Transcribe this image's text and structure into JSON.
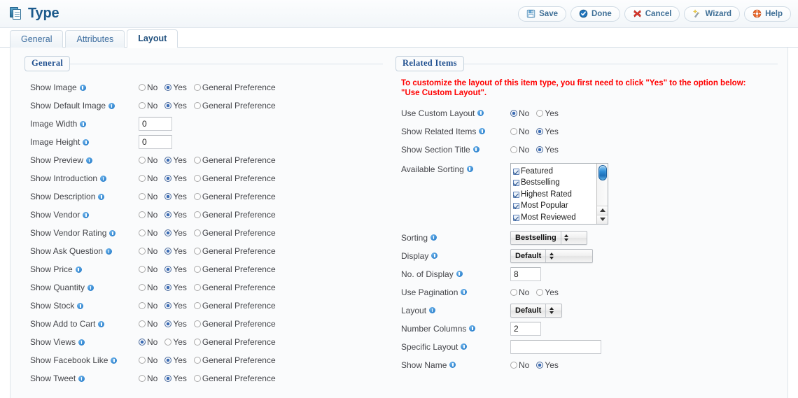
{
  "header": {
    "title": "Type",
    "icon": "copy-documents-icon",
    "toolbar": [
      {
        "label": "Save",
        "icon": "floppy-disk-icon"
      },
      {
        "label": "Done",
        "icon": "check-circle-icon"
      },
      {
        "label": "Cancel",
        "icon": "red-x-icon"
      },
      {
        "label": "Wizard",
        "icon": "magic-wand-icon"
      },
      {
        "label": "Help",
        "icon": "life-ring-icon"
      }
    ]
  },
  "tabs": [
    {
      "label": "General",
      "active": false
    },
    {
      "label": "Attributes",
      "active": false
    },
    {
      "label": "Layout",
      "active": true
    }
  ],
  "left": {
    "legend": "General",
    "radio_options": [
      "No",
      "Yes",
      "General Preference"
    ],
    "fields": [
      {
        "label": "Show Image",
        "type": "radio",
        "selected": "Yes"
      },
      {
        "label": "Show Default Image",
        "type": "radio",
        "selected": "Yes"
      },
      {
        "label": "Image Width",
        "type": "text",
        "value": "0"
      },
      {
        "label": "Image Height",
        "type": "text",
        "value": "0"
      },
      {
        "label": "Show Preview",
        "type": "radio",
        "selected": "Yes"
      },
      {
        "label": "Show Introduction",
        "type": "radio",
        "selected": "Yes"
      },
      {
        "label": "Show Description",
        "type": "radio",
        "selected": "Yes"
      },
      {
        "label": "Show Vendor",
        "type": "radio",
        "selected": "Yes"
      },
      {
        "label": "Show Vendor Rating",
        "type": "radio",
        "selected": "Yes"
      },
      {
        "label": "Show Ask Question",
        "type": "radio",
        "selected": "Yes"
      },
      {
        "label": "Show Price",
        "type": "radio",
        "selected": "Yes"
      },
      {
        "label": "Show Quantity",
        "type": "radio",
        "selected": "Yes"
      },
      {
        "label": "Show Stock",
        "type": "radio",
        "selected": "Yes"
      },
      {
        "label": "Show Add to Cart",
        "type": "radio",
        "selected": "Yes"
      },
      {
        "label": "Show Views",
        "type": "radio",
        "selected": "No"
      },
      {
        "label": "Show Facebook Like",
        "type": "radio",
        "selected": "Yes"
      },
      {
        "label": "Show Tweet",
        "type": "radio",
        "selected": "Yes"
      }
    ]
  },
  "right": {
    "legend": "Related Items",
    "warning": "To customize the layout of this item type, you first need to click \"Yes\" to the option below: \"Use Custom Layout\".",
    "yesno_options": [
      "No",
      "Yes"
    ],
    "available_sorting": {
      "label": "Available Sorting",
      "items": [
        {
          "label": "Featured",
          "checked": true
        },
        {
          "label": "Bestselling",
          "checked": true
        },
        {
          "label": "Highest Rated",
          "checked": true
        },
        {
          "label": "Most Popular",
          "checked": true
        },
        {
          "label": "Most Reviewed",
          "checked": true
        }
      ]
    },
    "fields": [
      {
        "label": "Use Custom Layout",
        "type": "radio",
        "selected": "No"
      },
      {
        "label": "Show Related Items",
        "type": "radio",
        "selected": "Yes"
      },
      {
        "label": "Show Section Title",
        "type": "radio",
        "selected": "Yes"
      },
      {
        "label": "Sorting",
        "type": "select",
        "value": "Bestselling"
      },
      {
        "label": "Display",
        "type": "select",
        "value": "Default"
      },
      {
        "label": "No. of Display",
        "type": "text",
        "value": "8"
      },
      {
        "label": "Use Pagination",
        "type": "radio",
        "selected": ""
      },
      {
        "label": "Layout",
        "type": "select",
        "value": "Default"
      },
      {
        "label": "Number Columns",
        "type": "text",
        "value": "2"
      },
      {
        "label": "Specific Layout",
        "type": "text",
        "value": ""
      },
      {
        "label": "Show Name",
        "type": "radio",
        "selected": "Yes"
      }
    ]
  },
  "colors": {
    "title": "#1c5a8c",
    "legend": "#1f4f8f",
    "warning": "#ff0000",
    "tab_active": "#1f4f7d",
    "accent": "#3b6cb5"
  }
}
